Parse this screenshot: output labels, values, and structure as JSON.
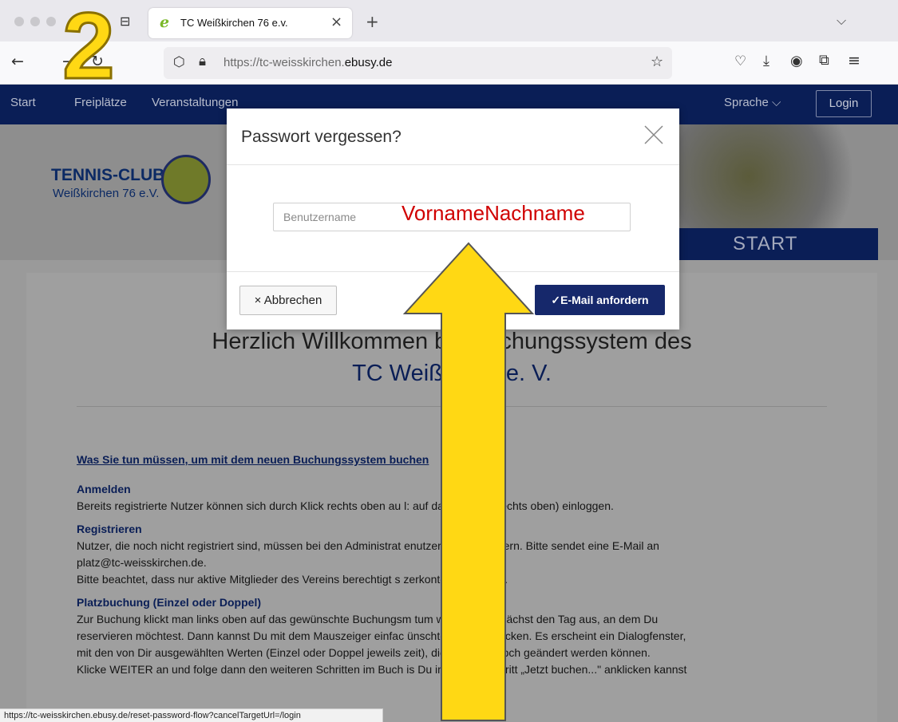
{
  "browser": {
    "tab_title": "TC Weißkirchen 76 e.v.",
    "tab_close": "×",
    "new_tab": "+",
    "tabs_dropdown": "⌵",
    "url_prefix": "https://tc-weisskirchen.",
    "url_domain": "ebusy.de",
    "status_url": "https://tc-weisskirchen.ebusy.de/reset-password-flow?cancelTargetUrl=/login"
  },
  "nav": {
    "items": [
      "Start",
      "Freiplätze",
      "Veranstaltungen"
    ],
    "language": "Sprache",
    "login": "Login"
  },
  "hero": {
    "logo_title": "TENNIS-CLUB",
    "logo_sub": "Weißkirchen 76 e.V.",
    "start": "START"
  },
  "content": {
    "welcome_line1": "Herzlich Willkommen bei   Buchungssystem des",
    "welcome_line2": "TC Weißkir          76 e. V.",
    "link": "Was Sie tun müssen, um mit dem neuen Buchungssystem buchen",
    "h_login": "Anmelden",
    "p_login": "Bereits registrierte Nutzer können sich durch Klick rechts oben au                    l: auf das Tür-Icon rechts oben) einloggen.",
    "h_register": "Registrieren",
    "p_register1": "Nutzer, die noch nicht registriert sind, müssen bei den Administrat                    enutzerkonto anfordern. Bitte sendet eine E-Mail an",
    "p_register2": "platz@tc-weisskirchen.de.",
    "p_register3": "Bitte beachtet, dass nur aktive Mitglieder des Vereins berechtigt s                    zerkonto zu erhalten.",
    "h_booking": "Platzbuchung (Einzel oder Doppel)",
    "p_booking1": "Zur Buchung klickt man links oben auf das gewünschte Buchungsm                    tum wählst Du zunächst den Tag aus, an dem Du",
    "p_booking2": "reservieren möchtest. Dann kannst Du mit dem Mauszeiger einfac                    ünschte Spielzeit klicken. Es erscheint ein Dialogfenster,",
    "p_booking3": "mit den von Dir ausgewählten Werten (Einzel oder Doppel jeweils                    zeit), die hier aber noch geändert werden können.",
    "p_booking4": "Klicke WEITER an und folge dann den weiteren Schritten im Buch                    is Du im letzten Schritt „Jetzt buchen...\" anklicken kannst"
  },
  "modal": {
    "title": "Passwort vergessen?",
    "username_placeholder": "Benutzername",
    "cancel_label": "Abbrechen",
    "submit_label": "E-Mail anfordern"
  },
  "annotation": {
    "step_number": "2",
    "hint_text": "VornameNachname"
  },
  "colors": {
    "nav_bg": "#0a1e56",
    "submit_bg": "#16286b",
    "annotation_yellow": "#ffd814",
    "annotation_red": "#d00000"
  }
}
